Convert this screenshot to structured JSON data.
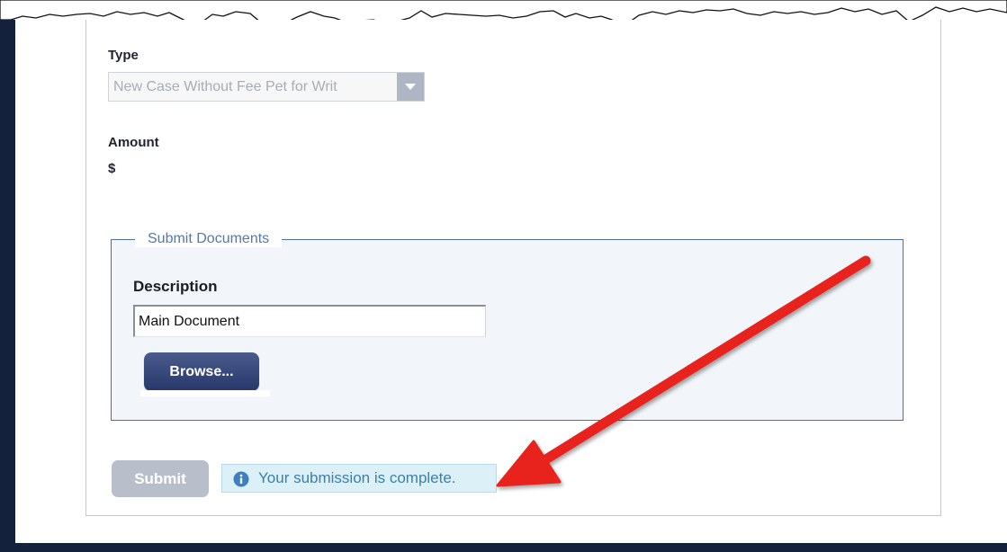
{
  "form": {
    "type_label": "Type",
    "type_value": "New Case Without Fee Pet for Writ",
    "amount_label": "Amount",
    "amount_value": "$"
  },
  "submit_documents": {
    "legend": "Submit Documents",
    "description_label": "Description",
    "description_value": "Main Document",
    "browse_label": "Browse..."
  },
  "actions": {
    "submit_label": "Submit",
    "submit_disabled": true
  },
  "notice": {
    "icon": "info-icon",
    "text": "Your submission is complete."
  },
  "colors": {
    "frame": "#14213d",
    "button_primary": "#2e3f72",
    "button_disabled": "#b9bfca",
    "notice_bg": "#dcf0f8",
    "notice_text": "#3f7fa6",
    "annotation_arrow": "#e8231c"
  }
}
